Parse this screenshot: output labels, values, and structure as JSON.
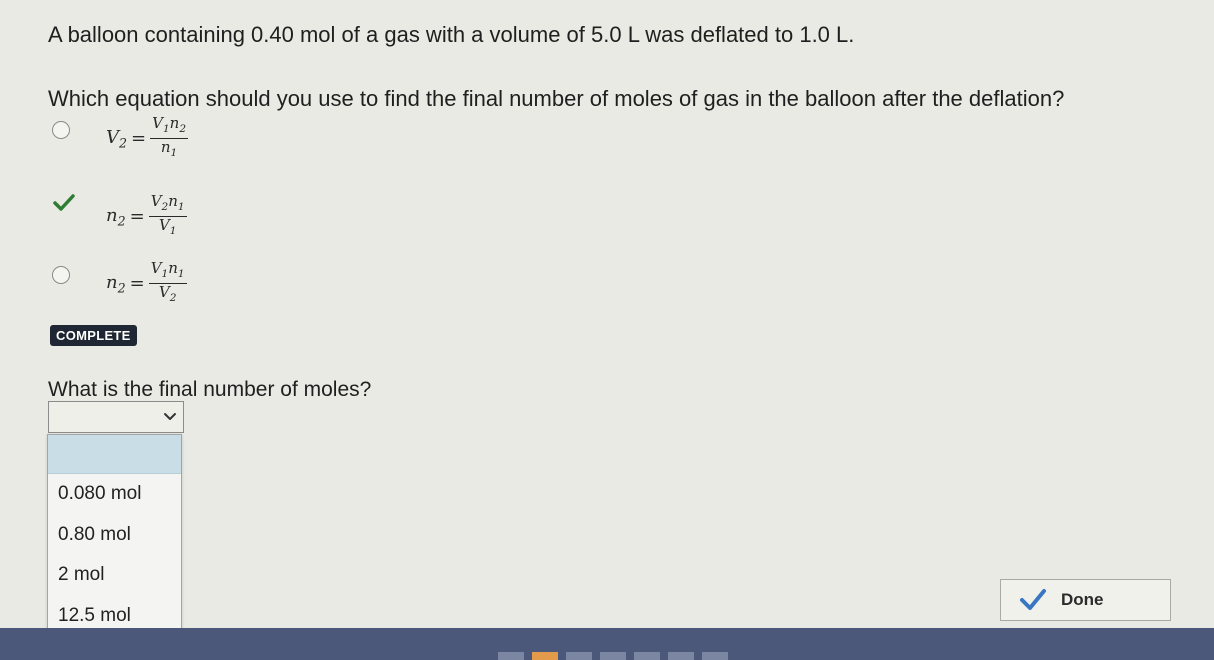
{
  "question": {
    "prompt": "A balloon containing 0.40 mol of a gas with a volume of 5.0 L was deflated to 1.0 L.",
    "part1": "Which equation should you use to find the final number of moles of gas in the balloon after the deflation?",
    "options": [
      {
        "lhs": "V2",
        "num": "V1n2",
        "den": "n1",
        "state": "unselected"
      },
      {
        "lhs": "n2",
        "num": "V2n1",
        "den": "V1",
        "state": "correct"
      },
      {
        "lhs": "n2",
        "num": "V1n1",
        "den": "V2",
        "state": "unselected"
      }
    ],
    "status_badge": "COMPLETE",
    "part2": "What is the final number of moles?"
  },
  "dropdown": {
    "selected": "",
    "options": [
      "0.080 mol",
      "0.80 mol",
      "2 mol",
      "12.5 mol"
    ]
  },
  "done_button": {
    "label": "Done"
  },
  "colors": {
    "accent_check": "#2e7d32",
    "badge_bg": "#1e2733",
    "highlight": "#c8dde6"
  }
}
